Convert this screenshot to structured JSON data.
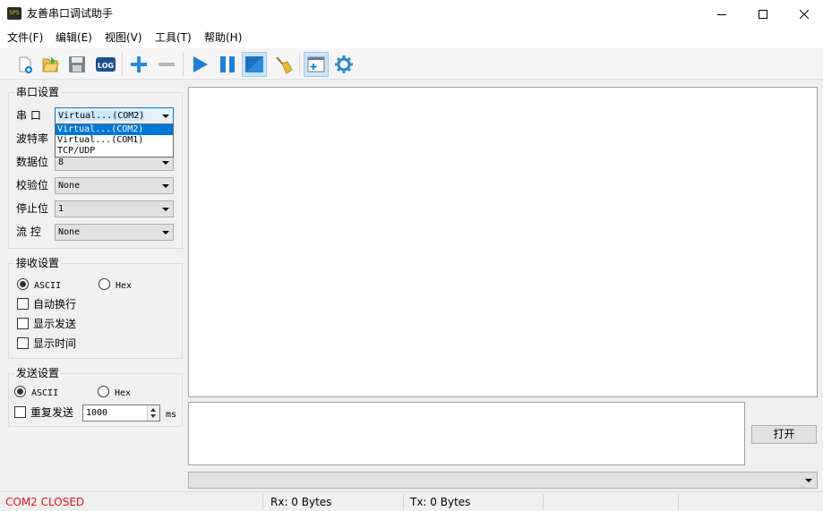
{
  "window": {
    "title": "友善串口调试助手",
    "icon": "app-logo-icon",
    "icon_text": "SPS",
    "controls": [
      "minimize-icon",
      "maximize-icon",
      "close-icon"
    ]
  },
  "menu": [
    {
      "label": "文件(F)"
    },
    {
      "label": "编辑(E)"
    },
    {
      "label": "视图(V)"
    },
    {
      "label": "工具(T)"
    },
    {
      "label": "帮助(H)"
    }
  ],
  "toolbar": {
    "buttons": [
      {
        "name": "new-icon"
      },
      {
        "name": "open-folder-icon"
      },
      {
        "name": "save-icon"
      },
      {
        "name": "log-icon",
        "text": "LOG"
      },
      {
        "name": "add-icon"
      },
      {
        "name": "remove-icon"
      },
      {
        "name": "play-icon"
      },
      {
        "name": "pause-icon"
      },
      {
        "name": "fill-screen-icon",
        "active": true
      },
      {
        "name": "broom-clear-icon"
      },
      {
        "name": "window-add-icon",
        "active": true
      },
      {
        "name": "gear-icon"
      }
    ]
  },
  "serial_settings": {
    "title": "串口设置",
    "port": {
      "label": "串  口",
      "value": "Virtual...(COM2)",
      "options": [
        "Virtual...(COM2)",
        "Virtual...(COM1)",
        "TCP/UDP"
      ],
      "selected_index": 0
    },
    "baud": {
      "label": "波特率"
    },
    "data_bits": {
      "label": "数据位",
      "value": "8"
    },
    "parity": {
      "label": "校验位",
      "value": "None"
    },
    "stop_bits": {
      "label": "停止位",
      "value": "1"
    },
    "flow": {
      "label": "流  控",
      "value": "None"
    }
  },
  "receive_settings": {
    "title": "接收设置",
    "ascii_label": "ASCII",
    "hex_label": "Hex",
    "mode": "ASCII",
    "auto_newline": "自动换行",
    "show_send": "显示发送",
    "show_time": "显示时间"
  },
  "send_settings": {
    "title": "发送设置",
    "ascii_label": "ASCII",
    "hex_label": "Hex",
    "mode": "ASCII",
    "repeat_label": "重复发送",
    "interval": "1000",
    "unit": "ms"
  },
  "actions": {
    "open_label": "打开"
  },
  "status": {
    "port_status": "COM2 CLOSED",
    "rx": "Rx: 0 Bytes",
    "tx": "Tx: 0 Bytes"
  },
  "colors": {
    "status_error": "#e81123",
    "selection": "#0078d7",
    "toolbar_blue": "#1e7fd6"
  }
}
